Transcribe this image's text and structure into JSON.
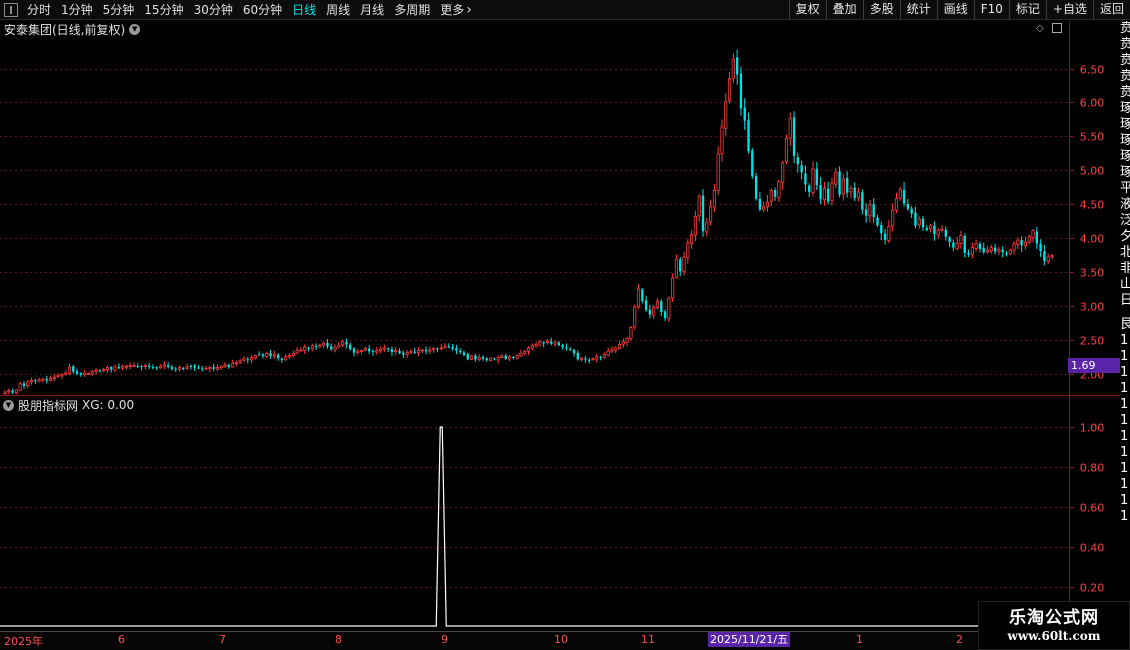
{
  "toolbar": {
    "periods": [
      {
        "label": "分时",
        "active": false
      },
      {
        "label": "1分钟",
        "active": false
      },
      {
        "label": "5分钟",
        "active": false
      },
      {
        "label": "15分钟",
        "active": false
      },
      {
        "label": "30分钟",
        "active": false
      },
      {
        "label": "60分钟",
        "active": false
      },
      {
        "label": "日线",
        "active": true
      },
      {
        "label": "周线",
        "active": false
      },
      {
        "label": "月线",
        "active": false
      },
      {
        "label": "多周期",
        "active": false
      },
      {
        "label": "更多",
        "active": false
      }
    ],
    "right_buttons": [
      "复权",
      "叠加",
      "多股",
      "统计",
      "画线",
      "F10",
      "标记",
      "+自选",
      "返回"
    ]
  },
  "main_panel": {
    "title": "安泰集团(日线,前复权)",
    "price_tag": "1.69"
  },
  "lower_panel": {
    "title": "股朋指标网",
    "value_text": "XG: 0.00"
  },
  "right_strip": [
    "贲",
    "贲",
    "贲",
    "贲",
    "贲",
    "琢",
    "琢",
    "琢",
    "琢",
    "琢",
    "平",
    "液",
    "泛",
    "夕",
    "北",
    "非",
    "山",
    "日",
    "艮",
    "1",
    "1",
    "1",
    "1",
    "1",
    "1",
    "1",
    "1",
    "1",
    "1",
    "1",
    "1"
  ],
  "date_axis": {
    "labels": [
      {
        "text": "2025年",
        "x": 4
      },
      {
        "text": "6",
        "x": 118
      },
      {
        "text": "7",
        "x": 219
      },
      {
        "text": "8",
        "x": 335
      },
      {
        "text": "9",
        "x": 441
      },
      {
        "text": "10",
        "x": 554
      },
      {
        "text": "11",
        "x": 641
      },
      {
        "text": "1",
        "x": 856
      },
      {
        "text": "2",
        "x": 956
      }
    ],
    "highlight_label": "2025/11/21/五",
    "highlight_x": 708
  },
  "watermark": {
    "name": "乐淘公式网",
    "url": "www.60lt.com"
  },
  "colors": {
    "up": "#ff3b3b",
    "down": "#00e3e3",
    "grid": "#5a1616",
    "axis_label": "#ff4040",
    "highlight": "#5a24a8",
    "active": "#00e5e5"
  },
  "chart_data": [
    {
      "type": "candlestick",
      "title": "安泰集团(日线,前复权)",
      "ylim": [
        1.7,
        6.95
      ],
      "y_ticks": [
        2.0,
        2.5,
        3.0,
        3.5,
        4.0,
        4.5,
        5.0,
        5.5,
        6.0,
        6.5
      ],
      "grid": true,
      "start_date": "2025-05-06",
      "closes": [
        1.73,
        1.75,
        1.72,
        1.76,
        1.85,
        1.82,
        1.88,
        1.9,
        1.89,
        1.91,
        1.92,
        1.9,
        1.93,
        1.95,
        1.97,
        1.99,
        2.01,
        2.1,
        2.03,
        2.0,
        1.98,
        2.01,
        2.0,
        2.03,
        2.05,
        2.04,
        2.06,
        2.09,
        2.06,
        2.1,
        2.08,
        2.11,
        2.11,
        2.12,
        2.12,
        2.11,
        2.1,
        2.12,
        2.1,
        2.09,
        2.08,
        2.11,
        2.13,
        2.1,
        2.07,
        2.06,
        2.09,
        2.08,
        2.1,
        2.11,
        2.09,
        2.08,
        2.07,
        2.08,
        2.09,
        2.07,
        2.09,
        2.11,
        2.13,
        2.1,
        2.15,
        2.16,
        2.19,
        2.22,
        2.2,
        2.24,
        2.27,
        2.28,
        2.26,
        2.3,
        2.26,
        2.28,
        2.23,
        2.2,
        2.25,
        2.27,
        2.3,
        2.34,
        2.35,
        2.39,
        2.37,
        2.41,
        2.4,
        2.42,
        2.45,
        2.4,
        2.36,
        2.39,
        2.42,
        2.47,
        2.43,
        2.36,
        2.31,
        2.33,
        2.34,
        2.37,
        2.33,
        2.32,
        2.34,
        2.36,
        2.38,
        2.36,
        2.32,
        2.34,
        2.3,
        2.28,
        2.31,
        2.33,
        2.31,
        2.34,
        2.35,
        2.33,
        2.35,
        2.37,
        2.36,
        2.38,
        2.41,
        2.39,
        2.37,
        2.34,
        2.32,
        2.28,
        2.21,
        2.26,
        2.21,
        2.24,
        2.22,
        2.2,
        2.23,
        2.21,
        2.24,
        2.26,
        2.22,
        2.25,
        2.24,
        2.27,
        2.3,
        2.33,
        2.38,
        2.41,
        2.43,
        2.47,
        2.45,
        2.48,
        2.44,
        2.46,
        2.42,
        2.39,
        2.37,
        2.35,
        2.3,
        2.21,
        2.23,
        2.21,
        2.2,
        2.22,
        2.25,
        2.24,
        2.28,
        2.33,
        2.35,
        2.38,
        2.43,
        2.47,
        2.52,
        2.68,
        2.98,
        3.25,
        3.07,
        2.94,
        2.87,
        2.98,
        3.07,
        2.91,
        2.82,
        3.11,
        3.41,
        3.69,
        3.51,
        3.72,
        3.93,
        4.05,
        4.32,
        4.62,
        4.1,
        4.23,
        4.46,
        4.7,
        5.24,
        5.64,
        6.01,
        6.35,
        6.64,
        6.41,
        5.91,
        5.73,
        5.28,
        4.91,
        4.58,
        4.42,
        4.46,
        4.53,
        4.7,
        4.61,
        4.83,
        5.11,
        5.47,
        5.76,
        5.21,
        5.09,
        4.97,
        4.79,
        4.68,
        5.02,
        4.78,
        4.57,
        4.73,
        4.54,
        4.81,
        4.97,
        4.64,
        4.87,
        4.67,
        4.73,
        4.59,
        4.68,
        4.42,
        4.33,
        4.49,
        4.31,
        4.19,
        4.07,
        3.97,
        4.17,
        4.41,
        4.58,
        4.72,
        4.51,
        4.43,
        4.36,
        4.18,
        4.28,
        4.16,
        4.12,
        4.18,
        4.06,
        4.11,
        4.13,
        4.02,
        3.94,
        3.86,
        3.92,
        4.04,
        3.78,
        3.76,
        3.86,
        3.92,
        3.84,
        3.79,
        3.82,
        3.86,
        3.8,
        3.83,
        3.79,
        3.76,
        3.82,
        3.91,
        3.97,
        3.89,
        3.94,
        4.02,
        4.11,
        3.92,
        3.81,
        3.66,
        3.72,
        3.74
      ]
    },
    {
      "type": "line",
      "title": "股朋指标网",
      "series": [
        {
          "name": "XG",
          "spike_index": 115,
          "spike_value": 1.0
        }
      ],
      "ylim": [
        0,
        1.07
      ],
      "y_ticks": [
        0.2,
        0.4,
        0.6,
        0.8,
        1.0
      ]
    }
  ]
}
